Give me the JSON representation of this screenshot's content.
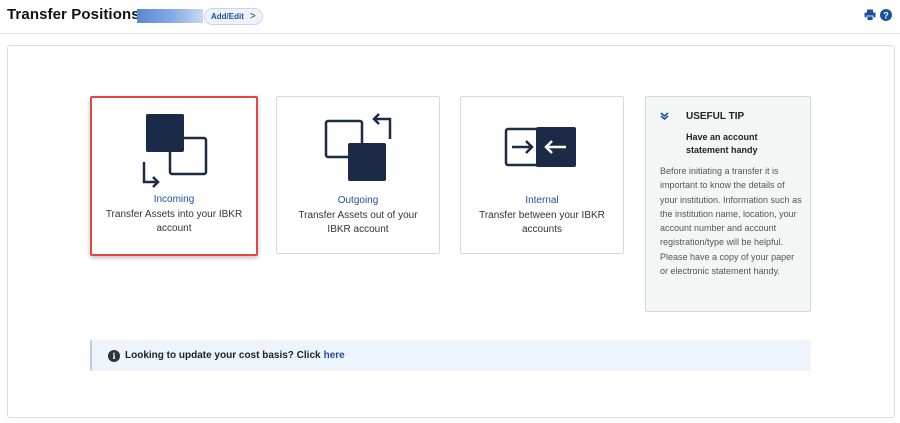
{
  "header": {
    "title": "Transfer Positions",
    "add_edit_label": "Add/Edit",
    "chevron": ">",
    "print_icon": "printer-icon",
    "help_icon": "help-icon"
  },
  "cards": [
    {
      "icon": "incoming-transfer-icon",
      "title": "Incoming",
      "desc": "Transfer Assets into your IBKR account",
      "selected": true
    },
    {
      "icon": "outgoing-transfer-icon",
      "title": "Outgoing",
      "desc": "Transfer Assets out of your IBKR account",
      "selected": false
    },
    {
      "icon": "internal-transfer-icon",
      "title": "Internal",
      "desc": "Transfer between your IBKR accounts",
      "selected": false
    }
  ],
  "tip": {
    "icon": "chevron-down-icon",
    "heading": "USEFUL TIP",
    "subheading": "Have an account statement handy",
    "body": "Before initiating a transfer it is important to know the details of your institution. Information such as the institution name, location, your account number and account registration/type will be helpful. Please have a copy of your paper or electronic statement handy."
  },
  "notice": {
    "icon": "info-icon",
    "text": "Looking to update your cost basis? Click",
    "link": "here"
  },
  "colors": {
    "accent": "#1f4f9f",
    "icon_dark": "#1b2a47",
    "selected_border": "#e04848",
    "notice_bg": "#edf4fc"
  }
}
